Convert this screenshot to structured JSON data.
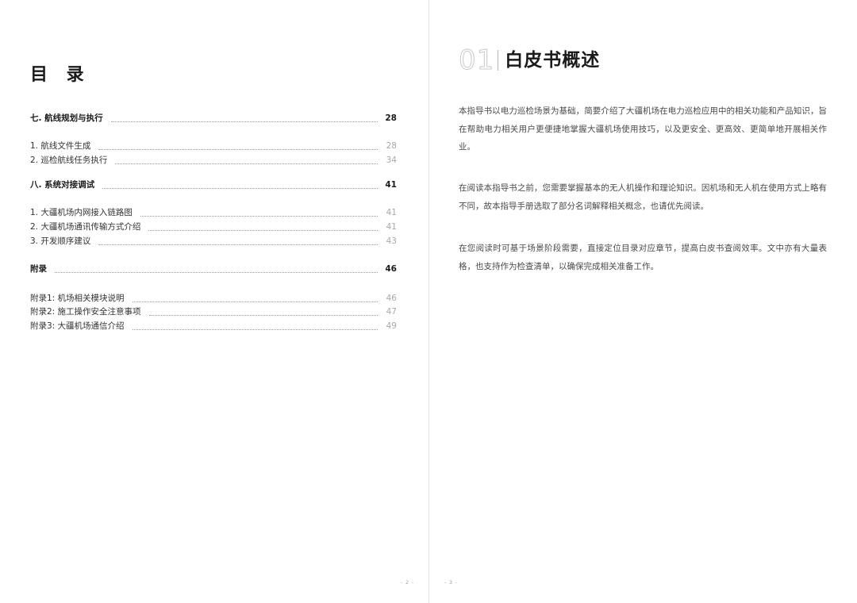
{
  "left_page": {
    "title": "目 录",
    "toc": [
      {
        "label": "七. 航线规划与执行",
        "page": "28",
        "level": "section"
      },
      {
        "label": "1. 航线文件生成",
        "page": "28",
        "level": "item"
      },
      {
        "label": "2. 巡检航线任务执行",
        "page": "34",
        "level": "item"
      },
      {
        "label": "八. 系统对接调试",
        "page": "41",
        "level": "section"
      },
      {
        "label": "1. 大疆机场内网接入链路图",
        "page": "41",
        "level": "item"
      },
      {
        "label": "2. 大疆机场通讯传输方式介绍",
        "page": "41",
        "level": "item"
      },
      {
        "label": "3. 开发顺序建议",
        "page": "43",
        "level": "item"
      },
      {
        "label": "附录",
        "page": "46",
        "level": "section"
      },
      {
        "label": "附录1: 机场相关模块说明",
        "page": "46",
        "level": "item"
      },
      {
        "label": "附录2: 施工操作安全注意事项",
        "page": "47",
        "level": "item"
      },
      {
        "label": "附录3: 大疆机场通信介绍",
        "page": "49",
        "level": "item"
      }
    ],
    "folio": "- 2 -"
  },
  "right_page": {
    "chapter_number": "01",
    "chapter_title": "白皮书概述",
    "paragraphs": [
      "本指导书以电力巡检场景为基础，简要介绍了大疆机场在电力巡检应用中的相关功能和产品知识，旨在帮助电力相关用户更便捷地掌握大疆机场使用技巧，以及更安全、更高效、更简单地开展相关作业。",
      "在阅读本指导书之前，您需要掌握基本的无人机操作和理论知识。因机场和无人机在使用方式上略有不同，故本指导手册选取了部分名词解释相关概念，也请优先阅读。",
      "在您阅读时可基于场景阶段需要，直接定位目录对应章节，提高白皮书查阅效率。文中亦有大量表格，也支持作为检查清单，以确保完成相关准备工作。"
    ],
    "folio": "- 3 -"
  }
}
